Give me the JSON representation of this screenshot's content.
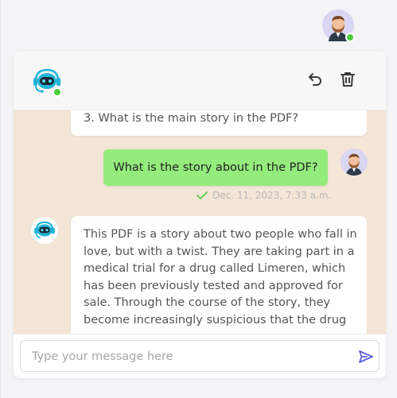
{
  "header": {
    "undo_icon": "undo-icon",
    "delete_icon": "trash-icon"
  },
  "messages": [
    {
      "role": "bot",
      "text": "3. What is the main story in the PDF?"
    },
    {
      "role": "user",
      "text": "What is the story about in the PDF?",
      "status_icon": "double-check-icon",
      "timestamp": "Dec. 11, 2023, 7:33 a.m."
    },
    {
      "role": "bot",
      "lines": [
        "This PDF is a story about two people who fall in",
        "love, but with a twist. They are taking part in a",
        "medical trial for a drug called Limeren, which",
        "has been previously tested and approved for",
        "sale. Through the course of the story, they",
        "become increasingly suspicious that the drug"
      ]
    }
  ],
  "composer": {
    "placeholder": "Type your message here",
    "value": "",
    "send_icon": "send-icon"
  },
  "colors": {
    "accent": "#5b5fd6",
    "user_bubble": "#94ec7c",
    "chat_background": "#f3e6d6",
    "online": "#4ccf3c"
  }
}
